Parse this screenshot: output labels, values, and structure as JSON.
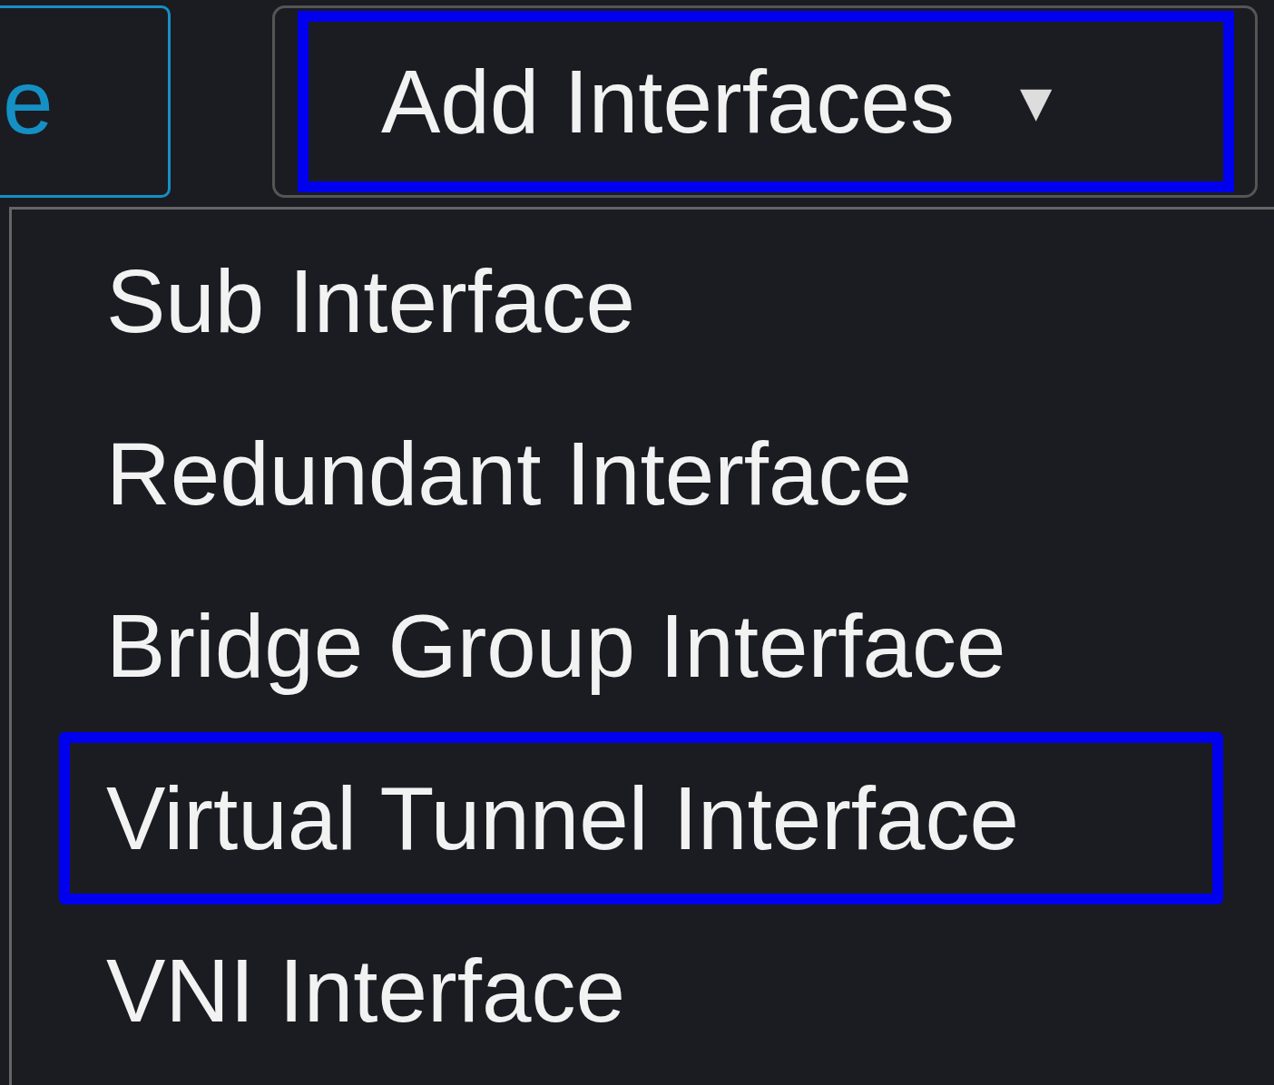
{
  "partial_button": {
    "label": "e"
  },
  "dropdown_button": {
    "label": "Add Interfaces",
    "caret": "▼",
    "highlighted": true
  },
  "menu": {
    "items": [
      {
        "label": "Sub Interface",
        "highlighted": false
      },
      {
        "label": "Redundant Interface",
        "highlighted": false
      },
      {
        "label": "Bridge Group Interface",
        "highlighted": false
      },
      {
        "label": "Virtual Tunnel Interface",
        "highlighted": true
      },
      {
        "label": "VNI Interface",
        "highlighted": false
      }
    ]
  }
}
